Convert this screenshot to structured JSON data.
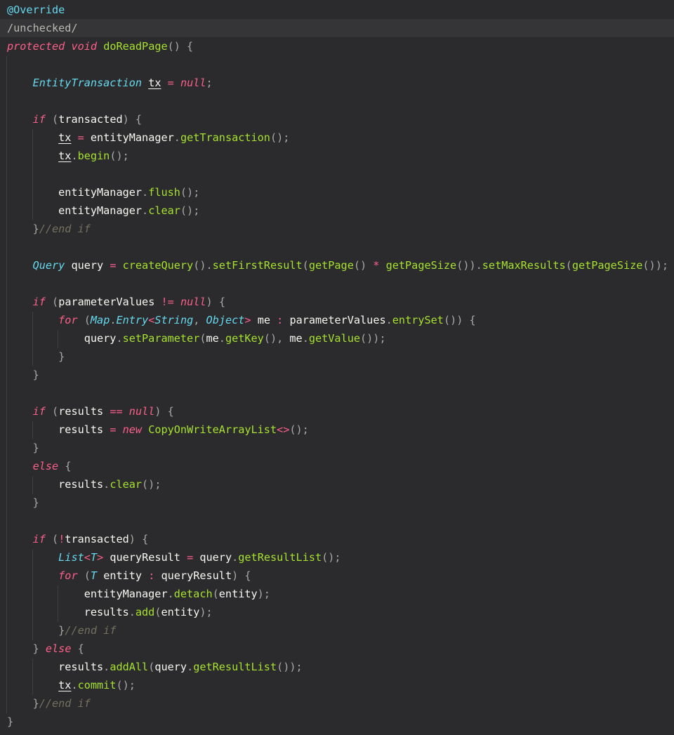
{
  "editor": {
    "highlighted_line": 2,
    "lines": [
      [
        [
          "ann",
          "@Override"
        ]
      ],
      [
        [
          "muted",
          "/unchecked/"
        ]
      ],
      [
        [
          "kw",
          "protected"
        ],
        [
          "id",
          " "
        ],
        [
          "kw",
          "void"
        ],
        [
          "id",
          " "
        ],
        [
          "fn",
          "doReadPage"
        ],
        [
          "pun",
          "() {"
        ]
      ],
      [],
      [
        [
          "id",
          "    "
        ],
        [
          "typ",
          "EntityTransaction"
        ],
        [
          "id",
          " "
        ],
        [
          "und",
          "tx"
        ],
        [
          "id",
          " "
        ],
        [
          "op",
          "="
        ],
        [
          "id",
          " "
        ],
        [
          "nul",
          "null"
        ],
        [
          "pun",
          ";"
        ]
      ],
      [],
      [
        [
          "id",
          "    "
        ],
        [
          "kw",
          "if"
        ],
        [
          "id",
          " "
        ],
        [
          "pun",
          "("
        ],
        [
          "id",
          "transacted"
        ],
        [
          "pun",
          ") {"
        ]
      ],
      [
        [
          "id",
          "        "
        ],
        [
          "und",
          "tx"
        ],
        [
          "id",
          " "
        ],
        [
          "op",
          "="
        ],
        [
          "id",
          " entityManager"
        ],
        [
          "pun",
          "."
        ],
        [
          "fn",
          "getTransaction"
        ],
        [
          "pun",
          "();"
        ]
      ],
      [
        [
          "id",
          "        "
        ],
        [
          "und",
          "tx"
        ],
        [
          "pun",
          "."
        ],
        [
          "fn",
          "begin"
        ],
        [
          "pun",
          "();"
        ]
      ],
      [],
      [
        [
          "id",
          "        entityManager"
        ],
        [
          "pun",
          "."
        ],
        [
          "fn",
          "flush"
        ],
        [
          "pun",
          "();"
        ]
      ],
      [
        [
          "id",
          "        entityManager"
        ],
        [
          "pun",
          "."
        ],
        [
          "fn",
          "clear"
        ],
        [
          "pun",
          "();"
        ]
      ],
      [
        [
          "id",
          "    "
        ],
        [
          "pun",
          "}"
        ],
        [
          "cmt",
          "//end if"
        ]
      ],
      [],
      [
        [
          "id",
          "    "
        ],
        [
          "typ",
          "Query"
        ],
        [
          "id",
          " query "
        ],
        [
          "op",
          "="
        ],
        [
          "id",
          " "
        ],
        [
          "fn",
          "createQuery"
        ],
        [
          "pun",
          "()."
        ],
        [
          "fn",
          "setFirstResult"
        ],
        [
          "pun",
          "("
        ],
        [
          "fn",
          "getPage"
        ],
        [
          "pun",
          "()"
        ],
        [
          "id",
          " "
        ],
        [
          "op",
          "*"
        ],
        [
          "id",
          " "
        ],
        [
          "fn",
          "getPageSize"
        ],
        [
          "pun",
          "())."
        ],
        [
          "fn",
          "setMaxResults"
        ],
        [
          "pun",
          "("
        ],
        [
          "fn",
          "getPageSize"
        ],
        [
          "pun",
          "());"
        ]
      ],
      [],
      [
        [
          "id",
          "    "
        ],
        [
          "kw",
          "if"
        ],
        [
          "id",
          " "
        ],
        [
          "pun",
          "("
        ],
        [
          "id",
          "parameterValues "
        ],
        [
          "op",
          "!="
        ],
        [
          "id",
          " "
        ],
        [
          "nul",
          "null"
        ],
        [
          "pun",
          ") {"
        ]
      ],
      [
        [
          "id",
          "        "
        ],
        [
          "kw",
          "for"
        ],
        [
          "id",
          " "
        ],
        [
          "pun",
          "("
        ],
        [
          "typ",
          "Map"
        ],
        [
          "pun",
          "."
        ],
        [
          "typ",
          "Entry"
        ],
        [
          "op",
          "<"
        ],
        [
          "typ",
          "String"
        ],
        [
          "pun",
          ", "
        ],
        [
          "typ",
          "Object"
        ],
        [
          "op",
          ">"
        ],
        [
          "id",
          " me "
        ],
        [
          "op",
          ":"
        ],
        [
          "id",
          " parameterValues"
        ],
        [
          "pun",
          "."
        ],
        [
          "fn",
          "entrySet"
        ],
        [
          "pun",
          "()) {"
        ]
      ],
      [
        [
          "id",
          "            query"
        ],
        [
          "pun",
          "."
        ],
        [
          "fn",
          "setParameter"
        ],
        [
          "pun",
          "("
        ],
        [
          "id",
          "me"
        ],
        [
          "pun",
          "."
        ],
        [
          "fn",
          "getKey"
        ],
        [
          "pun",
          "(), "
        ],
        [
          "id",
          "me"
        ],
        [
          "pun",
          "."
        ],
        [
          "fn",
          "getValue"
        ],
        [
          "pun",
          "());"
        ]
      ],
      [
        [
          "id",
          "        "
        ],
        [
          "pun",
          "}"
        ]
      ],
      [
        [
          "id",
          "    "
        ],
        [
          "pun",
          "}"
        ]
      ],
      [],
      [
        [
          "id",
          "    "
        ],
        [
          "kw",
          "if"
        ],
        [
          "id",
          " "
        ],
        [
          "pun",
          "("
        ],
        [
          "id",
          "results "
        ],
        [
          "op",
          "=="
        ],
        [
          "id",
          " "
        ],
        [
          "nul",
          "null"
        ],
        [
          "pun",
          ") {"
        ]
      ],
      [
        [
          "id",
          "        results "
        ],
        [
          "op",
          "="
        ],
        [
          "id",
          " "
        ],
        [
          "kw",
          "new"
        ],
        [
          "id",
          " "
        ],
        [
          "fn",
          "CopyOnWriteArrayList"
        ],
        [
          "op",
          "<>"
        ],
        [
          "pun",
          "();"
        ]
      ],
      [
        [
          "id",
          "    "
        ],
        [
          "pun",
          "}"
        ]
      ],
      [
        [
          "id",
          "    "
        ],
        [
          "kw",
          "else"
        ],
        [
          "id",
          " "
        ],
        [
          "pun",
          "{"
        ]
      ],
      [
        [
          "id",
          "        results"
        ],
        [
          "pun",
          "."
        ],
        [
          "fn",
          "clear"
        ],
        [
          "pun",
          "();"
        ]
      ],
      [
        [
          "id",
          "    "
        ],
        [
          "pun",
          "}"
        ]
      ],
      [],
      [
        [
          "id",
          "    "
        ],
        [
          "kw",
          "if"
        ],
        [
          "id",
          " "
        ],
        [
          "pun",
          "("
        ],
        [
          "op",
          "!"
        ],
        [
          "id",
          "transacted"
        ],
        [
          "pun",
          ") {"
        ]
      ],
      [
        [
          "id",
          "        "
        ],
        [
          "typ",
          "List"
        ],
        [
          "op",
          "<"
        ],
        [
          "typ",
          "T"
        ],
        [
          "op",
          ">"
        ],
        [
          "id",
          " queryResult "
        ],
        [
          "op",
          "="
        ],
        [
          "id",
          " query"
        ],
        [
          "pun",
          "."
        ],
        [
          "fn",
          "getResultList"
        ],
        [
          "pun",
          "();"
        ]
      ],
      [
        [
          "id",
          "        "
        ],
        [
          "kw",
          "for"
        ],
        [
          "id",
          " "
        ],
        [
          "pun",
          "("
        ],
        [
          "typ",
          "T"
        ],
        [
          "id",
          " entity "
        ],
        [
          "op",
          ":"
        ],
        [
          "id",
          " queryResult"
        ],
        [
          "pun",
          ") {"
        ]
      ],
      [
        [
          "id",
          "            entityManager"
        ],
        [
          "pun",
          "."
        ],
        [
          "fn",
          "detach"
        ],
        [
          "pun",
          "("
        ],
        [
          "id",
          "entity"
        ],
        [
          "pun",
          ");"
        ]
      ],
      [
        [
          "id",
          "            results"
        ],
        [
          "pun",
          "."
        ],
        [
          "fn",
          "add"
        ],
        [
          "pun",
          "("
        ],
        [
          "id",
          "entity"
        ],
        [
          "pun",
          ");"
        ]
      ],
      [
        [
          "id",
          "        "
        ],
        [
          "pun",
          "}"
        ],
        [
          "cmt",
          "//end if"
        ]
      ],
      [
        [
          "id",
          "    "
        ],
        [
          "pun",
          "}"
        ],
        [
          "id",
          " "
        ],
        [
          "kw",
          "else"
        ],
        [
          "id",
          " "
        ],
        [
          "pun",
          "{"
        ]
      ],
      [
        [
          "id",
          "        results"
        ],
        [
          "pun",
          "."
        ],
        [
          "fn",
          "addAll"
        ],
        [
          "pun",
          "("
        ],
        [
          "id",
          "query"
        ],
        [
          "pun",
          "."
        ],
        [
          "fn",
          "getResultList"
        ],
        [
          "pun",
          "());"
        ]
      ],
      [
        [
          "id",
          "        "
        ],
        [
          "und",
          "tx"
        ],
        [
          "pun",
          "."
        ],
        [
          "fn",
          "commit"
        ],
        [
          "pun",
          "();"
        ]
      ],
      [
        [
          "id",
          "    "
        ],
        [
          "pun",
          "}"
        ],
        [
          "cmt",
          "//end if"
        ]
      ],
      [
        [
          "pun",
          "}"
        ]
      ]
    ]
  }
}
